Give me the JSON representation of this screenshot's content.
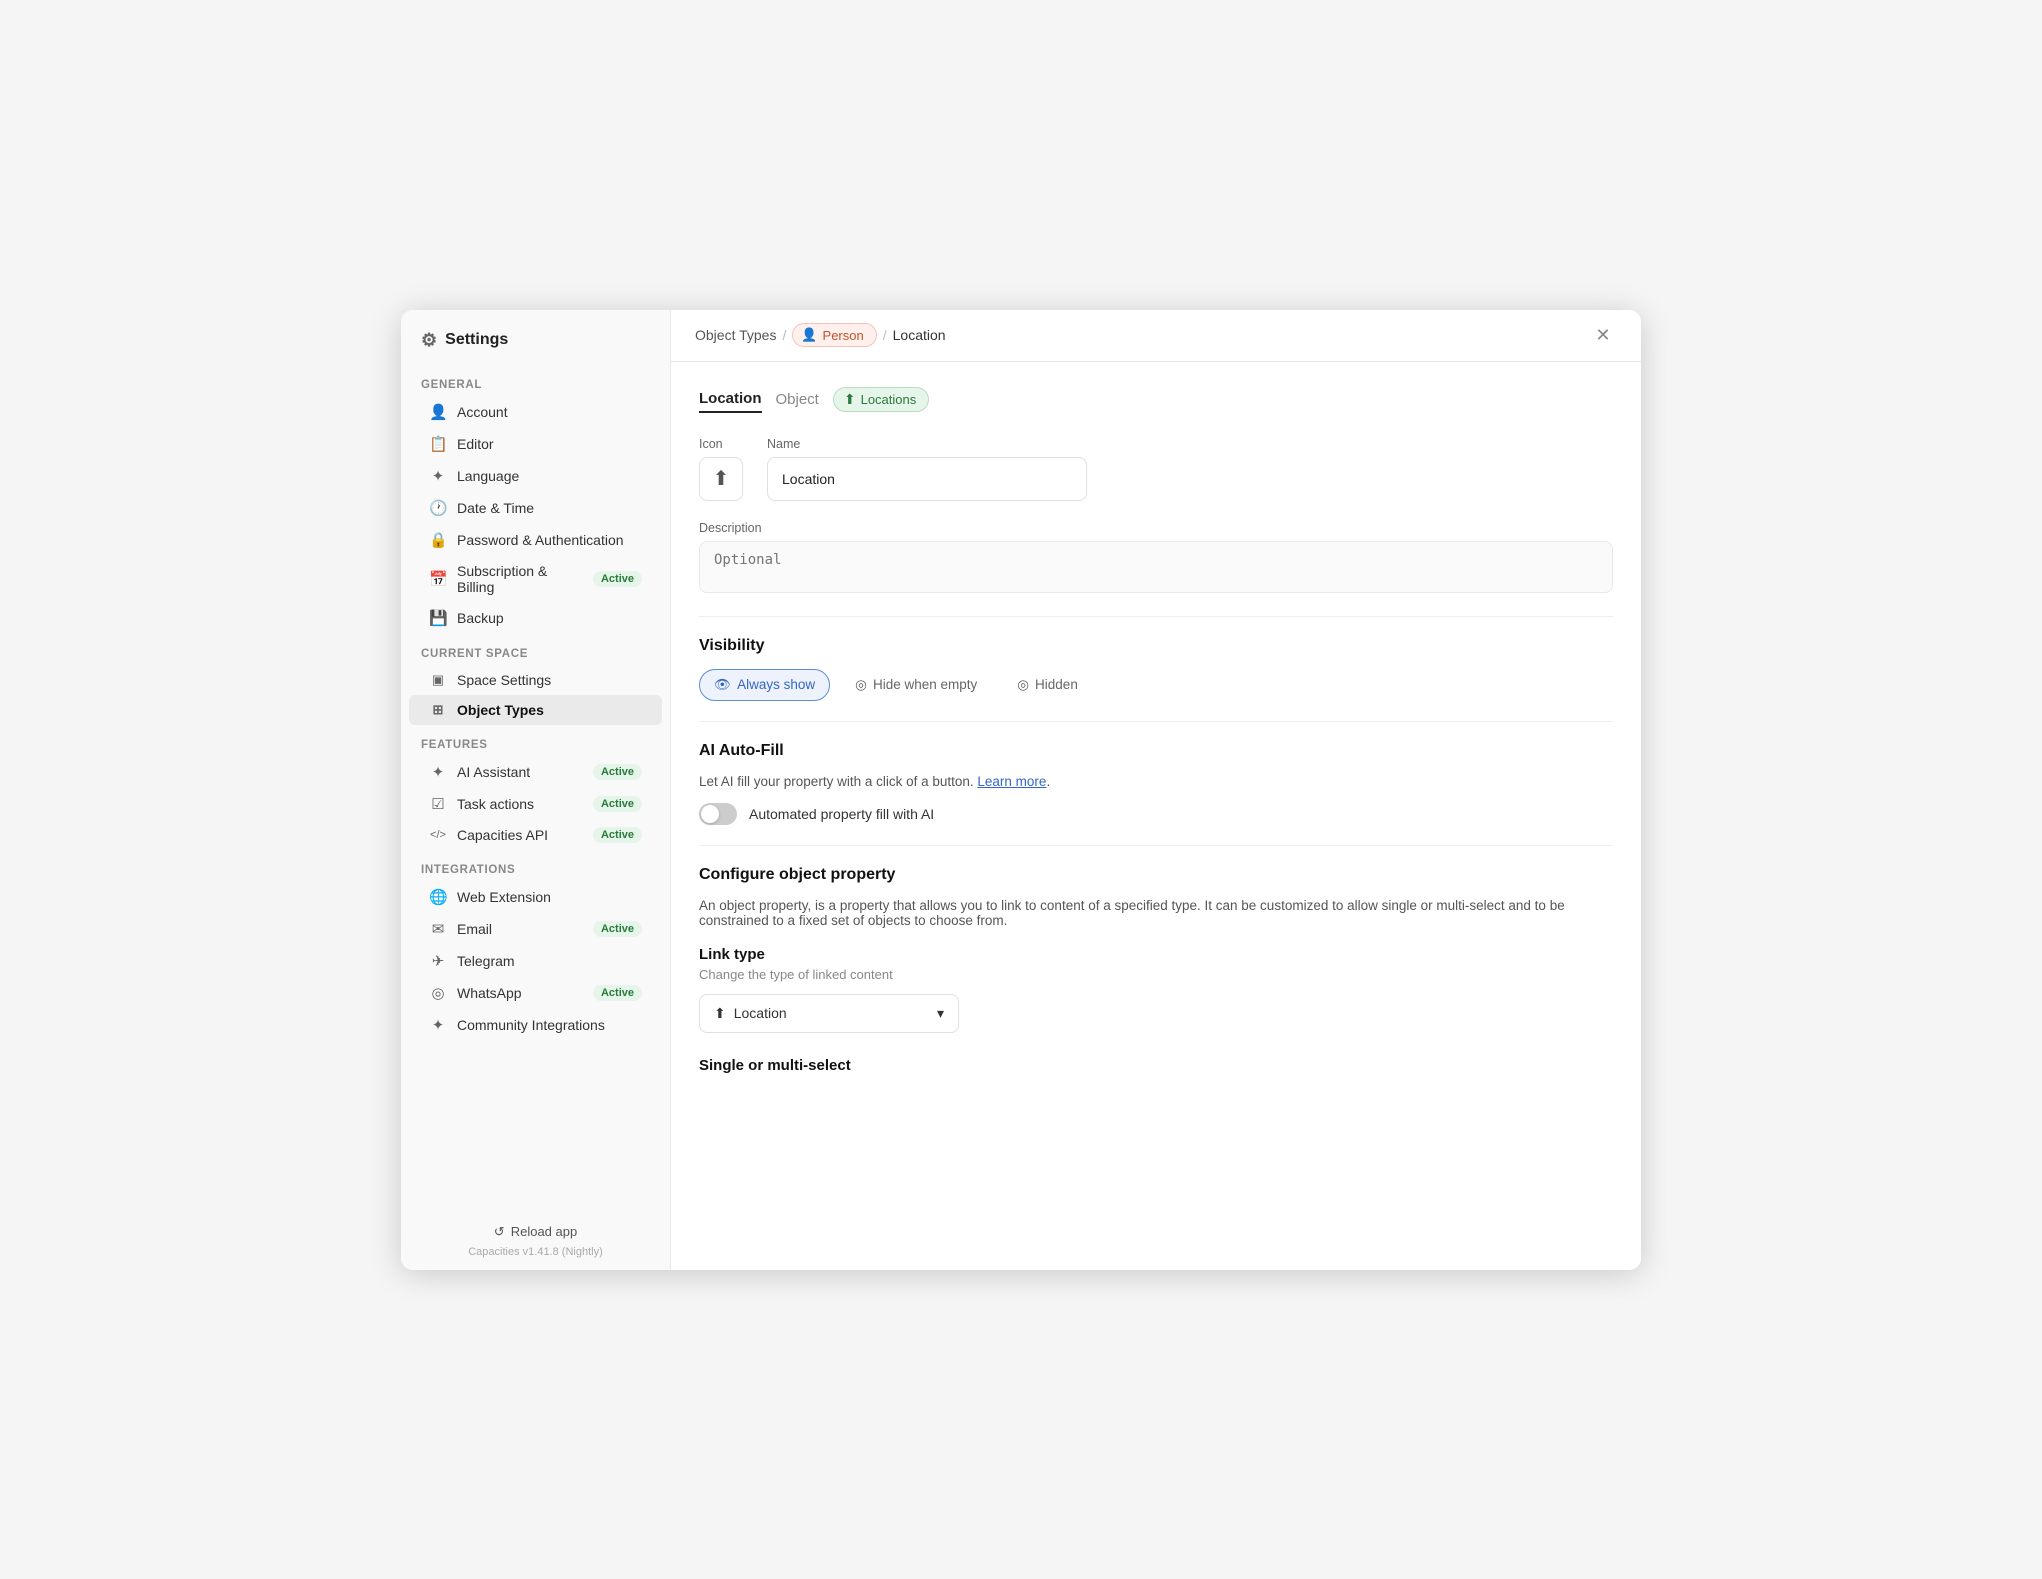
{
  "app": {
    "title": "Settings",
    "gear_icon": "⚙",
    "version": "Capacities v1.41.8 (Nightly)",
    "reload_label": "Reload app"
  },
  "sidebar": {
    "general_label": "General",
    "current_space_label": "Current space",
    "features_label": "Features",
    "integrations_label": "Integrations",
    "items_general": [
      {
        "id": "account",
        "label": "Account",
        "icon": "👤"
      },
      {
        "id": "editor",
        "label": "Editor",
        "icon": "📋"
      },
      {
        "id": "language",
        "label": "Language",
        "icon": "✦"
      },
      {
        "id": "datetime",
        "label": "Date & Time",
        "icon": "🕐"
      },
      {
        "id": "password",
        "label": "Password & Authentication",
        "icon": "🔒"
      },
      {
        "id": "billing",
        "label": "Subscription & Billing",
        "icon": "📅",
        "badge": "Active"
      },
      {
        "id": "backup",
        "label": "Backup",
        "icon": "💾"
      }
    ],
    "items_space": [
      {
        "id": "space-settings",
        "label": "Space Settings",
        "icon": "▣"
      },
      {
        "id": "object-types",
        "label": "Object Types",
        "icon": "⊞",
        "active": true
      }
    ],
    "items_features": [
      {
        "id": "ai-assistant",
        "label": "AI Assistant",
        "icon": "✦",
        "badge": "Active"
      },
      {
        "id": "task-actions",
        "label": "Task actions",
        "icon": "☑",
        "badge": "Active"
      },
      {
        "id": "capacities-api",
        "label": "Capacities API",
        "icon": "</>",
        "badge": "Active"
      }
    ],
    "items_integrations": [
      {
        "id": "web-extension",
        "label": "Web Extension",
        "icon": "🌐"
      },
      {
        "id": "email",
        "label": "Email",
        "icon": "✉",
        "badge": "Active"
      },
      {
        "id": "telegram",
        "label": "Telegram",
        "icon": "✈"
      },
      {
        "id": "whatsapp",
        "label": "WhatsApp",
        "icon": "◎",
        "badge": "Active"
      },
      {
        "id": "community",
        "label": "Community Integrations",
        "icon": "✦"
      }
    ]
  },
  "topbar": {
    "breadcrumb_object_types": "Object Types",
    "breadcrumb_sep1": "/",
    "breadcrumb_person": "Person",
    "person_icon": "👤",
    "breadcrumb_sep2": "/",
    "breadcrumb_location": "Location",
    "close_icon": "✕"
  },
  "tabs": {
    "location_label": "Location",
    "object_label": "Object",
    "locations_badge": "Locations",
    "locations_icon": "⬆"
  },
  "form": {
    "icon_label": "Icon",
    "name_label": "Name",
    "name_value": "Location",
    "name_placeholder": "Location",
    "desc_label": "Description",
    "desc_placeholder": "Optional",
    "location_icon": "⬆"
  },
  "visibility": {
    "title": "Visibility",
    "always_show_label": "Always show",
    "always_show_icon": "👁",
    "hide_when_empty_label": "Hide when empty",
    "hide_when_empty_icon": "◎",
    "hidden_label": "Hidden",
    "hidden_icon": "◎"
  },
  "ai_autofill": {
    "title": "AI Auto-Fill",
    "desc_before": "Let AI fill your property with a click of a button. ",
    "learn_more": "Learn more",
    "desc_after": ".",
    "toggle_label": "Automated property fill with AI"
  },
  "configure": {
    "title": "Configure object property",
    "desc": "An object property, is a property that allows you to link to content of a specified type. It can be customized to allow single or multi-select and to be constrained to a fixed set of objects to choose from.",
    "link_type_title": "Link type",
    "link_type_sub": "Change the type of linked content",
    "link_type_value": "Location",
    "link_type_icon": "⬆",
    "single_multi_title": "Single or multi-select"
  }
}
